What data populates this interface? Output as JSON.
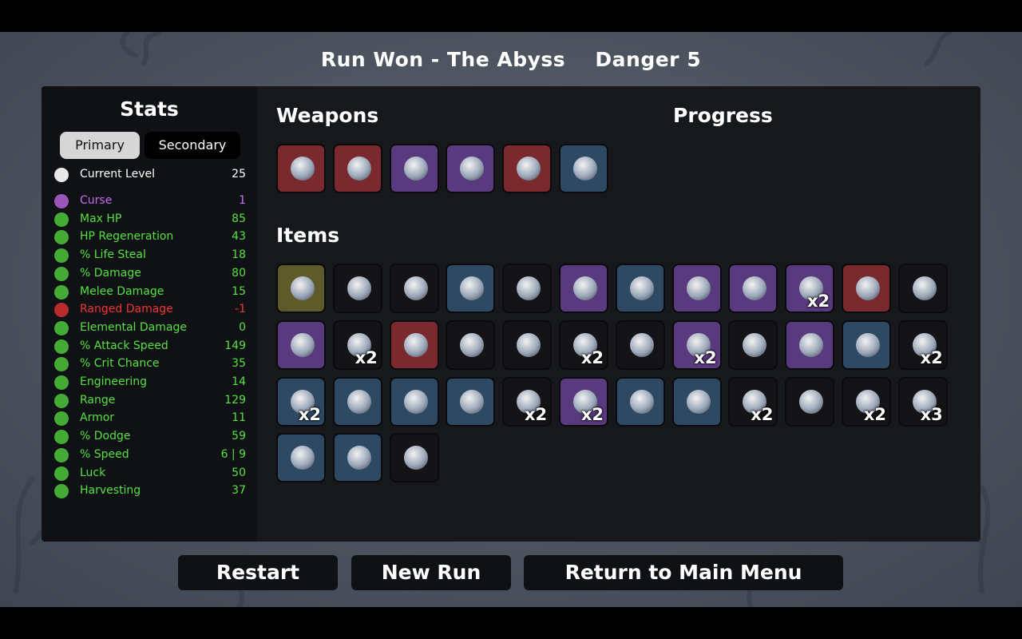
{
  "header": {
    "result": "Run Won - The Abyss",
    "danger": "Danger 5"
  },
  "stats": {
    "title": "Stats",
    "tabs": {
      "primary": "Primary",
      "secondary": "Secondary"
    },
    "current_level": {
      "label": "Current Level",
      "value": "25"
    },
    "rows": [
      {
        "icon": "curse-icon",
        "label": "Curse",
        "value": "1",
        "color": "#c66df0"
      },
      {
        "icon": "heart-icon",
        "label": "Max HP",
        "value": "85",
        "color": "#56e042"
      },
      {
        "icon": "hp-regeneration-icon",
        "label": "HP Regeneration",
        "value": "43",
        "color": "#56e042"
      },
      {
        "icon": "life-steal-icon",
        "label": "% Life Steal",
        "value": "18",
        "color": "#56e042"
      },
      {
        "icon": "damage-icon",
        "label": "% Damage",
        "value": "80",
        "color": "#56e042"
      },
      {
        "icon": "melee-sword-icon",
        "label": "Melee Damage",
        "value": "15",
        "color": "#56e042"
      },
      {
        "icon": "ranged-bow-icon",
        "label": "Ranged Damage",
        "value": "-1",
        "color": "#f03434"
      },
      {
        "icon": "flame-icon",
        "label": "Elemental Damage",
        "value": "0",
        "color": "#56e042"
      },
      {
        "icon": "hourglass-icon",
        "label": "% Attack Speed",
        "value": "149",
        "color": "#56e042"
      },
      {
        "icon": "crit-icon",
        "label": "% Crit Chance",
        "value": "35",
        "color": "#56e042"
      },
      {
        "icon": "engineering-icon",
        "label": "Engineering",
        "value": "14",
        "color": "#56e042"
      },
      {
        "icon": "range-icon",
        "label": "Range",
        "value": "129",
        "color": "#56e042"
      },
      {
        "icon": "shield-icon",
        "label": "Armor",
        "value": "11",
        "color": "#56e042"
      },
      {
        "icon": "dodge-icon",
        "label": "% Dodge",
        "value": "59",
        "color": "#56e042"
      },
      {
        "icon": "speed-boot-icon",
        "label": "% Speed",
        "value": "6 | 9",
        "color": "#56e042"
      },
      {
        "icon": "dice-icon",
        "label": "Luck",
        "value": "50",
        "color": "#56e042"
      },
      {
        "icon": "wheat-icon",
        "label": "Harvesting",
        "value": "37",
        "color": "#56e042"
      }
    ]
  },
  "weapons": {
    "title": "Weapons",
    "list": [
      {
        "icon": "crystal-shard-icon",
        "tier": "#7a2a2f"
      },
      {
        "icon": "crystal-shard-icon",
        "tier": "#7a2a2f"
      },
      {
        "icon": "skull-staff-icon",
        "tier": "#5a3a7e"
      },
      {
        "icon": "axe-icon",
        "tier": "#5a3a7e"
      },
      {
        "icon": "axe-icon",
        "tier": "#7a2a2f"
      },
      {
        "icon": "crystal-shard-icon",
        "tier": "#2e4a63"
      }
    ]
  },
  "progress": {
    "title": "Progress"
  },
  "items": {
    "title": "Items",
    "list": [
      {
        "icon": "egg-mask-icon",
        "tier": "#5e5a2a",
        "count": ""
      },
      {
        "icon": "slime-icon",
        "tier": "#141417",
        "count": ""
      },
      {
        "icon": "tooth-icon",
        "tier": "#141417",
        "count": ""
      },
      {
        "icon": "tentacle-icon",
        "tier": "#2e4a63",
        "count": ""
      },
      {
        "icon": "snowball-icon",
        "tier": "#141417",
        "count": ""
      },
      {
        "icon": "dead-plant-icon",
        "tier": "#5a3a7e",
        "count": ""
      },
      {
        "icon": "blade-icon",
        "tier": "#2e4a63",
        "count": ""
      },
      {
        "icon": "mortar-icon",
        "tier": "#5a3a7e",
        "count": ""
      },
      {
        "icon": "pink-blob-icon",
        "tier": "#5a3a7e",
        "count": ""
      },
      {
        "icon": "helmet-icon",
        "tier": "#5a3a7e",
        "count": "x2"
      },
      {
        "icon": "scarf-icon",
        "tier": "#7a2a2f",
        "count": ""
      },
      {
        "icon": "bat-icon",
        "tier": "#141417",
        "count": ""
      },
      {
        "icon": "robot-icon",
        "tier": "#5a3a7e",
        "count": ""
      },
      {
        "icon": "green-alien-icon",
        "tier": "#141417",
        "count": "x2"
      },
      {
        "icon": "scroll-icon",
        "tier": "#7a2a2f",
        "count": ""
      },
      {
        "icon": "snake-icon",
        "tier": "#141417",
        "count": ""
      },
      {
        "icon": "bag-icon",
        "tier": "#141417",
        "count": ""
      },
      {
        "icon": "map-icon",
        "tier": "#141417",
        "count": "x2"
      },
      {
        "icon": "eyes-icon",
        "tier": "#141417",
        "count": ""
      },
      {
        "icon": "horn-icon",
        "tier": "#5a3a7e",
        "count": "x2"
      },
      {
        "icon": "skull-mask-icon",
        "tier": "#141417",
        "count": ""
      },
      {
        "icon": "goggles-icon",
        "tier": "#5a3a7e",
        "count": ""
      },
      {
        "icon": "octopus-icon",
        "tier": "#2e4a63",
        "count": ""
      },
      {
        "icon": "lizard-icon",
        "tier": "#141417",
        "count": "x2"
      },
      {
        "icon": "chain-icon",
        "tier": "#2e4a63",
        "count": "x2"
      },
      {
        "icon": "cloth-icon",
        "tier": "#2e4a63",
        "count": ""
      },
      {
        "icon": "target-ring-icon",
        "tier": "#2e4a63",
        "count": ""
      },
      {
        "icon": "cocoon-icon",
        "tier": "#2e4a63",
        "count": ""
      },
      {
        "icon": "syringe-icon",
        "tier": "#141417",
        "count": "x2"
      },
      {
        "icon": "mirror-icon",
        "tier": "#5a3a7e",
        "count": "x2"
      },
      {
        "icon": "bracelet-icon",
        "tier": "#2e4a63",
        "count": ""
      },
      {
        "icon": "bone-icon",
        "tier": "#2e4a63",
        "count": ""
      },
      {
        "icon": "branch-icon",
        "tier": "#141417",
        "count": "x2"
      },
      {
        "icon": "boxing-glove-icon",
        "tier": "#141417",
        "count": ""
      },
      {
        "icon": "propeller-hat-icon",
        "tier": "#141417",
        "count": "x2"
      },
      {
        "icon": "knife-icon",
        "tier": "#141417",
        "count": "x3"
      },
      {
        "icon": "vest-icon",
        "tier": "#2e4a63",
        "count": ""
      },
      {
        "icon": "jar-icon",
        "tier": "#2e4a63",
        "count": ""
      },
      {
        "icon": "cake-icon",
        "tier": "#141417",
        "count": ""
      }
    ]
  },
  "buttons": {
    "restart": "Restart",
    "new_run": "New Run",
    "main_menu": "Return to Main Menu"
  },
  "colors": {
    "tier_common": "#141417",
    "tier_uncommon": "#2e4a63",
    "tier_rare": "#5a3a7e",
    "tier_legendary": "#7a2a2f",
    "stat_positive": "#56e042",
    "stat_negative": "#f03434",
    "curse": "#c66df0"
  }
}
